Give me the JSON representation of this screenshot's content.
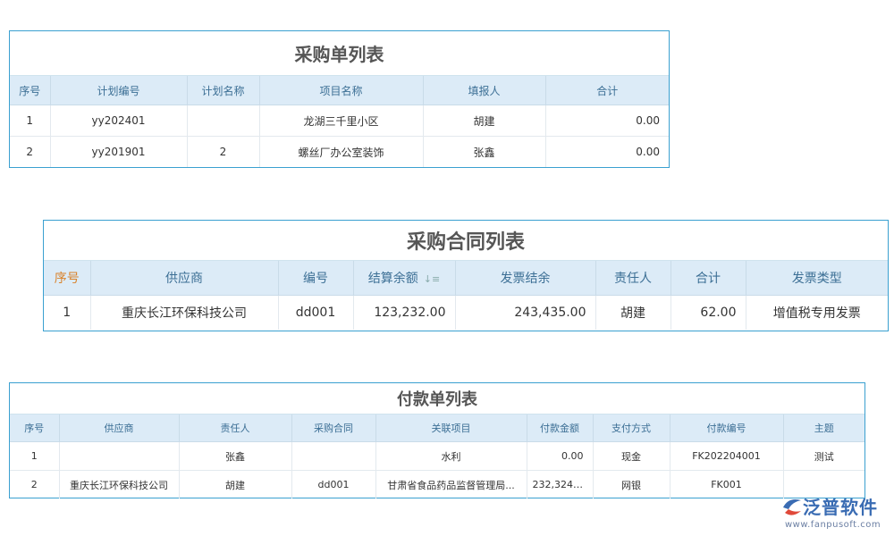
{
  "purchase_orders": {
    "title": "采购单列表",
    "columns": [
      "序号",
      "计划编号",
      "计划名称",
      "项目名称",
      "填报人",
      "合计"
    ],
    "rows": [
      [
        "1",
        "yy202401",
        "",
        "龙湖三千里小区",
        "胡建",
        "0.00"
      ],
      [
        "2",
        "yy201901",
        "2",
        "螺丝厂办公室装饰",
        "张鑫",
        "0.00"
      ]
    ]
  },
  "purchase_contracts": {
    "title": "采购合同列表",
    "columns": [
      "序号",
      "供应商",
      "编号",
      "结算余额",
      "发票结余",
      "责任人",
      "合计",
      "发票类型"
    ],
    "sort_icon": "sort-desc-icon",
    "sort_glyph": "↓≡",
    "rows": [
      [
        "1",
        "重庆长江环保科技公司",
        "dd001",
        "123,232.00",
        "243,435.00",
        "胡建",
        "62.00",
        "增值税专用发票"
      ]
    ]
  },
  "payments": {
    "title": "付款单列表",
    "columns": [
      "序号",
      "供应商",
      "责任人",
      "采购合同",
      "关联项目",
      "付款金额",
      "支付方式",
      "付款编号",
      "主题"
    ],
    "rows": [
      [
        "1",
        "",
        "张鑫",
        "",
        "水利",
        "0.00",
        "现金",
        "FK202204001",
        "测试"
      ],
      [
        "2",
        "重庆长江环保科技公司",
        "胡建",
        "dd001",
        "甘肃省食品药品监督管理局...",
        "232,324.00",
        "网银",
        "FK001",
        ""
      ]
    ]
  },
  "logo": {
    "brand": "泛普软件",
    "url": "www.fanpusoft.com",
    "colors": {
      "blue": "#3a6cb3",
      "red": "#e0493a"
    }
  }
}
